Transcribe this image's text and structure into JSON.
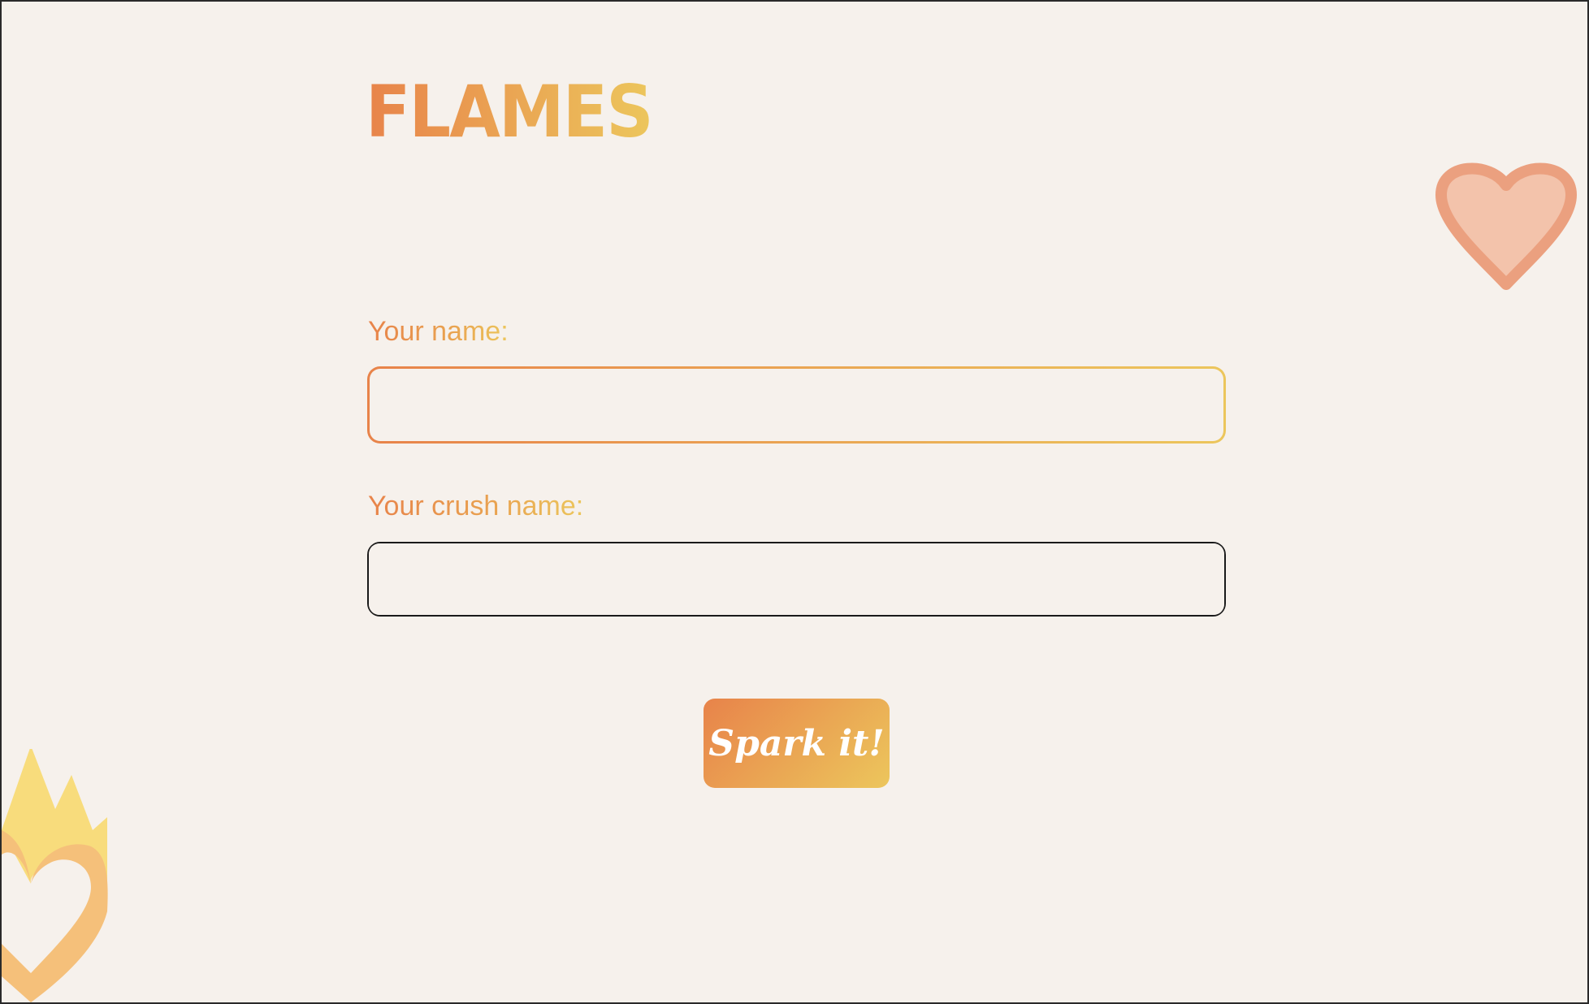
{
  "app": {
    "title": "FLAMES"
  },
  "form": {
    "name_label": "Your name:",
    "name_value": "",
    "crush_label": "Your crush name:",
    "crush_value": "",
    "submit_label": "Spark it!"
  },
  "colors": {
    "background": "#f6f1ec",
    "gradient_start": "#e8834a",
    "gradient_end": "#ecc65c",
    "heart_fill": "#f3c3ab",
    "heart_stroke": "#eba07f",
    "flame_yellow": "#f8dc7c",
    "flame_orange": "#f5c07a"
  },
  "icons": {
    "decorative_right": "heart-icon",
    "decorative_left": "flame-heart-icon"
  }
}
